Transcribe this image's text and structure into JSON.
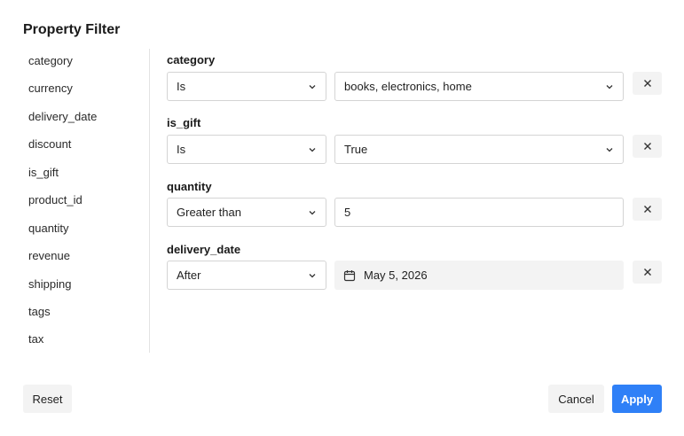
{
  "title": "Property Filter",
  "sidebar": {
    "items": [
      "category",
      "currency",
      "delivery_date",
      "discount",
      "is_gift",
      "product_id",
      "quantity",
      "revenue",
      "shipping",
      "tags",
      "tax"
    ]
  },
  "filters": [
    {
      "label": "category",
      "operator": "Is",
      "value": "books, electronics, home"
    },
    {
      "label": "is_gift",
      "operator": "Is",
      "value": "True"
    },
    {
      "label": "quantity",
      "operator": "Greater than",
      "value": "5"
    },
    {
      "label": "delivery_date",
      "operator": "After",
      "value": "May 5, 2026"
    }
  ],
  "footer": {
    "reset_label": "Reset",
    "cancel_label": "Cancel",
    "apply_label": "Apply"
  },
  "colors": {
    "accent": "#2f80f7",
    "button_bg": "#f3f3f3",
    "border": "#d4d4d4"
  },
  "icons": {
    "dropdown": "chevron-down-icon",
    "remove": "close-icon",
    "date": "calendar-icon"
  }
}
